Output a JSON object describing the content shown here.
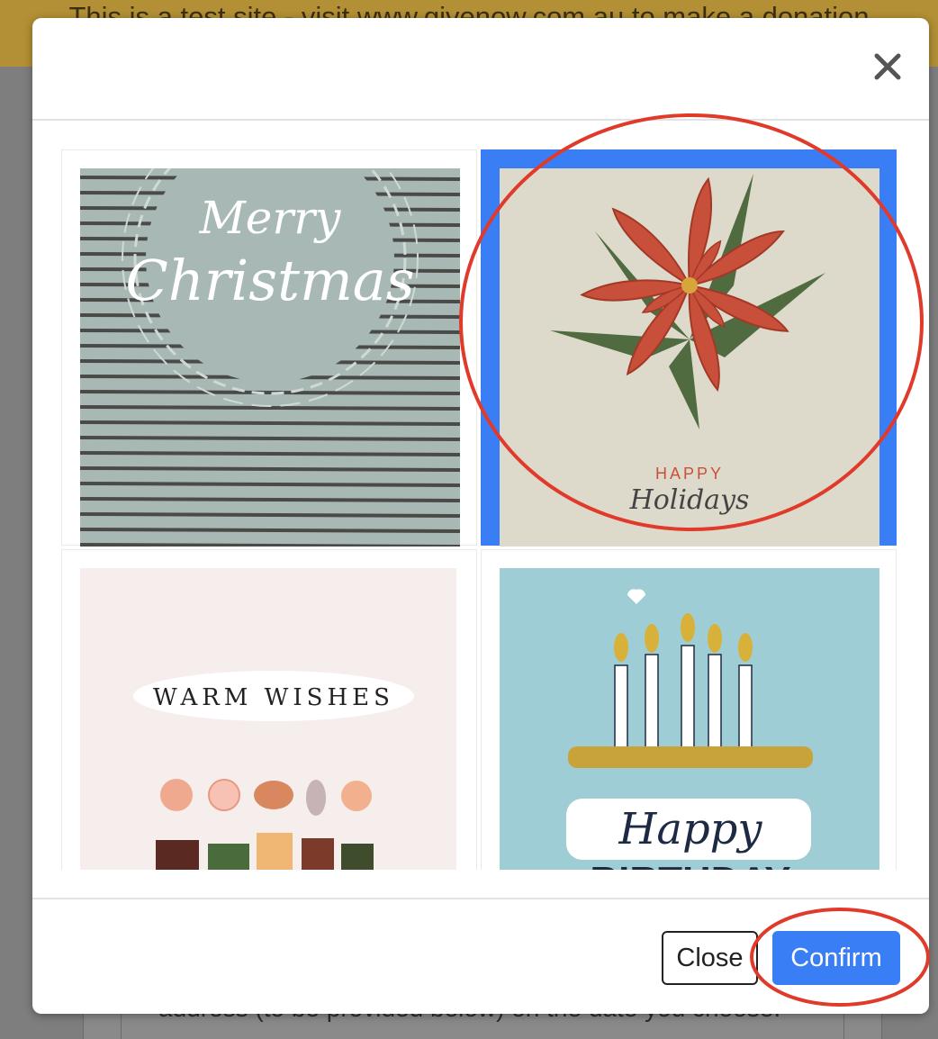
{
  "banner": {
    "text": "This is a test site - visit www.givenow.com.au to make a donation"
  },
  "background": {
    "form_text": "address (to be provided below) on the date you choose."
  },
  "modal": {
    "close_icon": "close-icon",
    "cards": [
      {
        "name": "merry-christmas",
        "line1": "Merry",
        "line2": "Christmas",
        "selected": false
      },
      {
        "name": "happy-holidays",
        "line1": "HAPPY",
        "line2": "Holidays",
        "selected": true
      },
      {
        "name": "warm-wishes",
        "line1": "WARM WISHES",
        "selected": false
      },
      {
        "name": "happy-birthday",
        "line1": "Happy",
        "line2": "BIRTHDAY",
        "selected": false
      }
    ],
    "footer": {
      "close_label": "Close",
      "confirm_label": "Confirm"
    }
  },
  "colors": {
    "accent": "#3a7ef5",
    "annotation": "#e03a2b",
    "banner": "#b39035"
  }
}
